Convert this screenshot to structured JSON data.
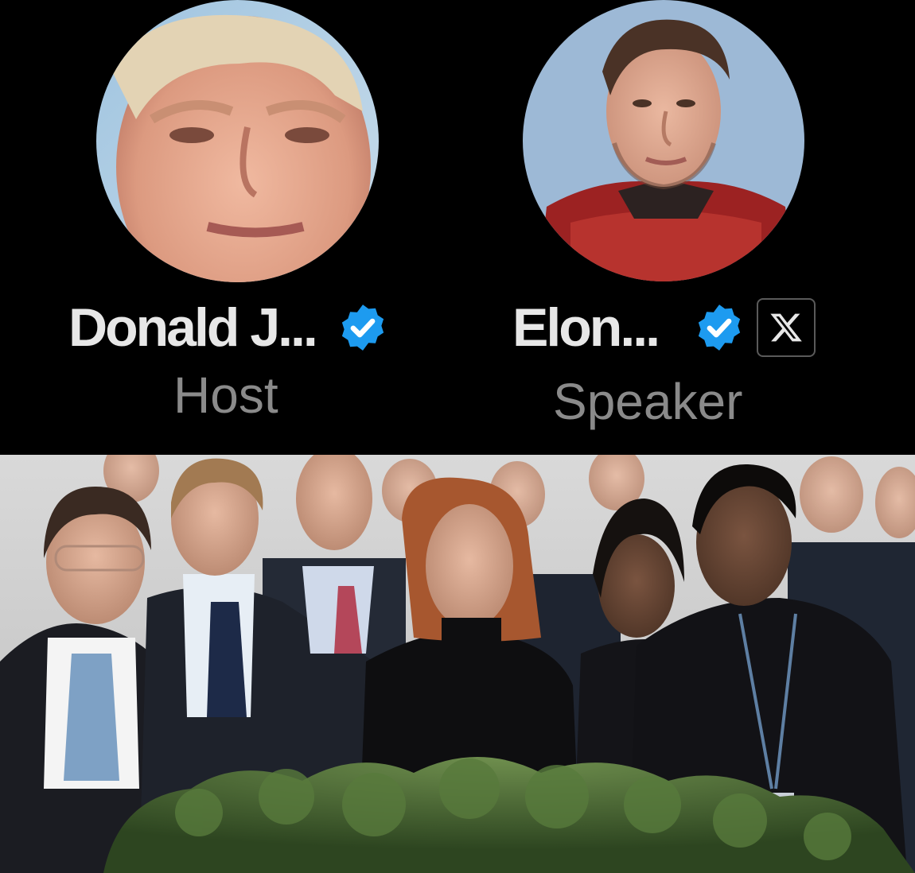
{
  "speakers": [
    {
      "name": "Donald J...",
      "role": "Host",
      "verified_icon": "verified-badge-icon",
      "avatar": "avatar-photo"
    },
    {
      "name": "Elon...",
      "role": "Speaker",
      "verified_icon": "verified-badge-icon",
      "affiliate_icon": "x-logo-icon",
      "avatar": "avatar-photo"
    }
  ],
  "colors": {
    "background": "#000000",
    "name_text": "#e7e7e7",
    "role_text": "#8a8a8a",
    "verified_blue": "#1d9bf0"
  },
  "bottom_image": "group-photo"
}
